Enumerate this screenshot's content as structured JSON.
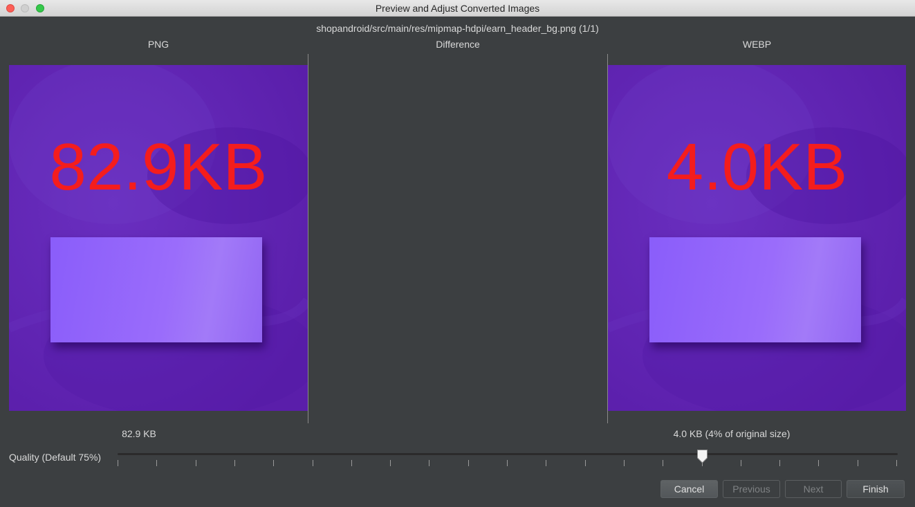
{
  "window": {
    "title": "Preview and Adjust Converted Images"
  },
  "file": {
    "path": "shopandroid/src/main/res/mipmap-hdpi/earn_header_bg.png (1/1)"
  },
  "columns": {
    "original": "PNG",
    "difference": "Difference",
    "converted": "WEBP"
  },
  "previews": {
    "original_overlay_text": "82.9KB",
    "converted_overlay_text": "4.0KB",
    "background_color": "#5c1fb0",
    "overlay_text_color": "#f41d1d"
  },
  "sizes": {
    "original": "82.9 KB",
    "converted": "4.0 KB (4% of original size)"
  },
  "quality": {
    "label": "Quality (Default 75%)",
    "value_percent": 75,
    "tick_count": 21
  },
  "buttons": {
    "cancel": "Cancel",
    "previous": "Previous",
    "next": "Next",
    "finish": "Finish"
  }
}
